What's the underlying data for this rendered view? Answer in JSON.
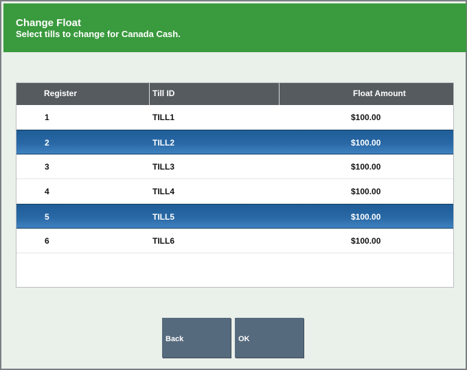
{
  "header": {
    "title": "Change Float",
    "subtitle": "Select tills to change for Canada Cash."
  },
  "table": {
    "columns": [
      "Register",
      "Till ID",
      "Float Amount"
    ],
    "rows": [
      {
        "register": "1",
        "till_id": "TILL1",
        "float_amount": "$100.00",
        "selected": false
      },
      {
        "register": "2",
        "till_id": "TILL2",
        "float_amount": "$100.00",
        "selected": true
      },
      {
        "register": "3",
        "till_id": "TILL3",
        "float_amount": "$100.00",
        "selected": false
      },
      {
        "register": "4",
        "till_id": "TILL4",
        "float_amount": "$100.00",
        "selected": false
      },
      {
        "register": "5",
        "till_id": "TILL5",
        "float_amount": "$100.00",
        "selected": true
      },
      {
        "register": "6",
        "till_id": "TILL6",
        "float_amount": "$100.00",
        "selected": false
      }
    ]
  },
  "buttons": {
    "back_label": "Back",
    "ok_label": "OK"
  },
  "colors": {
    "header_green": "#3a9a3e",
    "table_header": "#565b60",
    "selected_row": "#2968a5",
    "button": "#566a7d"
  }
}
